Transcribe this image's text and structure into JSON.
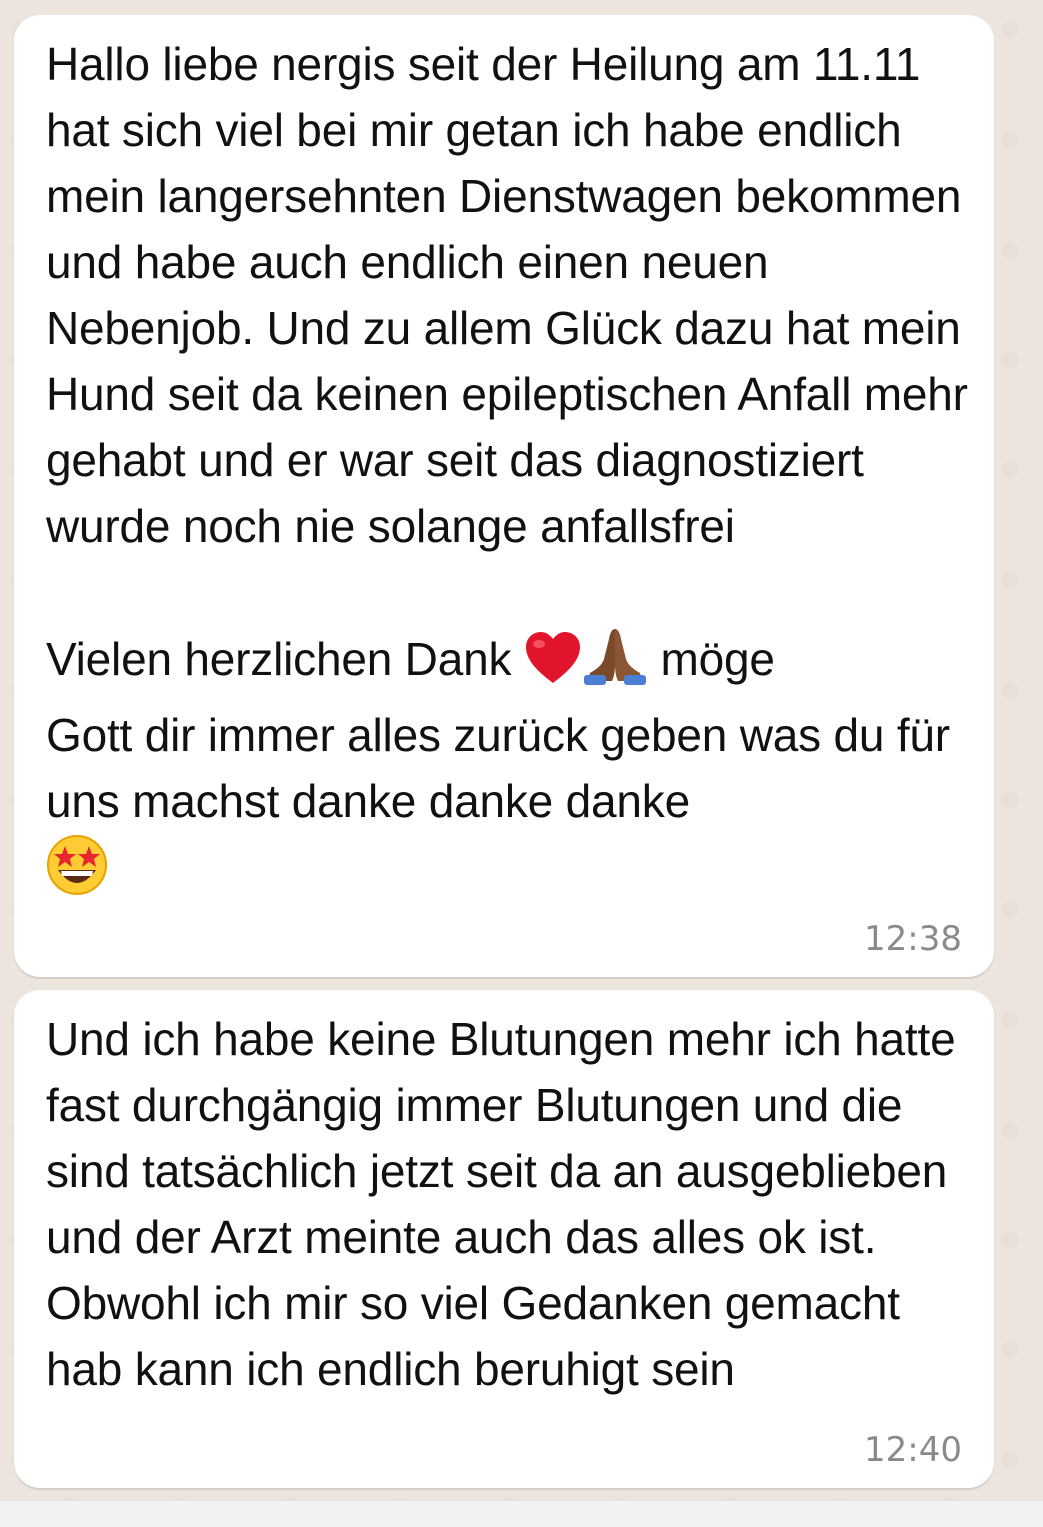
{
  "messages": [
    {
      "paragraph1": "Hallo liebe nergis seit der Heilung am 11.11 hat sich viel bei mir getan ich habe endlich mein langersehnten Dienstwagen bekommen und habe auch endlich einen neuen Nebenjob. Und zu allem Glück dazu hat mein Hund seit da keinen epileptischen Anfall mehr gehabt und er war seit das diagnostiziert wurde noch nie solange anfallsfrei",
      "line_a": "Vielen herzlichen Dank",
      "line_b": "möge",
      "line_c": "Gott dir immer alles zurück geben was du für uns machst danke danke danke",
      "time": "12:38"
    },
    {
      "text": "Und ich habe keine Blutungen mehr ich hatte fast durchgängig immer Blutungen und die sind tatsächlich jetzt seit da an ausgeblieben und der Arzt meinte auch das alles ok ist. Obwohl ich mir so viel Gedanken gemacht hab kann ich endlich beruhigt sein",
      "time": "12:40"
    }
  ],
  "icons": [
    "heart-emoji",
    "praying-hands-emoji",
    "star-struck-emoji"
  ],
  "colors": {
    "background": "#ece5dd",
    "bubble": "#ffffff",
    "text": "#111111",
    "timestamp": "#8a8a8a"
  }
}
